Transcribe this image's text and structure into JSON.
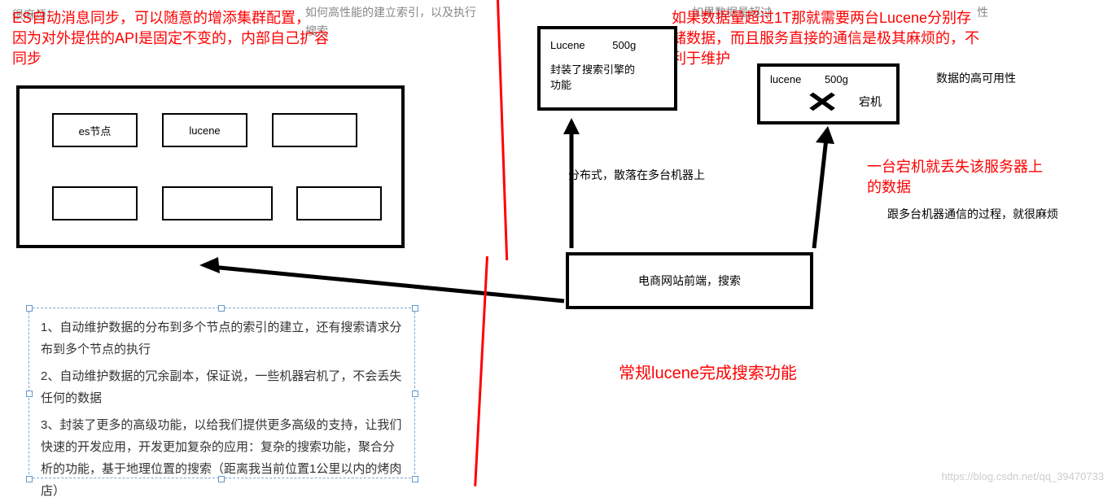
{
  "faded_bg": {
    "top_left": "很麻烦！",
    "top_center": "如何高性能的建立索引，以及执行",
    "top_center2": "搜索",
    "top_right": "如果数据量超过",
    "top_right2": "性"
  },
  "red_annotations": {
    "es_sync": "ES自动消息同步，可以随意的增添集群配置，\n因为对外提供的API是固定不变的，内部自己扩容\n同步",
    "lucene_problem": "如果数据量超过1T那就需要两台Lucene分别存\n储数据，而且服务直接的通信是极其麻烦的，不\n利于维护",
    "data_loss": "一台宕机就丢失该服务器上\n的数据",
    "lucene_search": "常规lucene完成搜索功能"
  },
  "black_annotations": {
    "data_ha": "数据的高可用性",
    "multi_comm": "跟多台机器通信的过程，就很麻烦",
    "distributed": "分布式，散落在多台机器上"
  },
  "es_cluster": {
    "node1": "es节点",
    "node2": "lucene"
  },
  "lucene_box1": {
    "title": "Lucene",
    "size": "500g",
    "desc1": "封装了搜索引擎的",
    "desc2": "功能"
  },
  "lucene_box2": {
    "title": "lucene",
    "size": "500g",
    "status": "宕机"
  },
  "frontend_box": {
    "label": "电商网站前端，搜索"
  },
  "notes": {
    "line1": "1、自动维护数据的分布到多个节点的索引的建立，还有搜索请求分布到多个节点的执行",
    "line2": "2、自动维护数据的冗余副本，保证说，一些机器宕机了，不会丢失任何的数据",
    "line3": "3、封装了更多的高级功能，以给我们提供更多高级的支持，让我们快速的开发应用，开发更加复杂的应用：复杂的搜索功能，聚合分析的功能，基于地理位置的搜索（距离我当前位置1公里以内的烤肉店）"
  },
  "watermark": "https://blog.csdn.net/qq_39470733"
}
